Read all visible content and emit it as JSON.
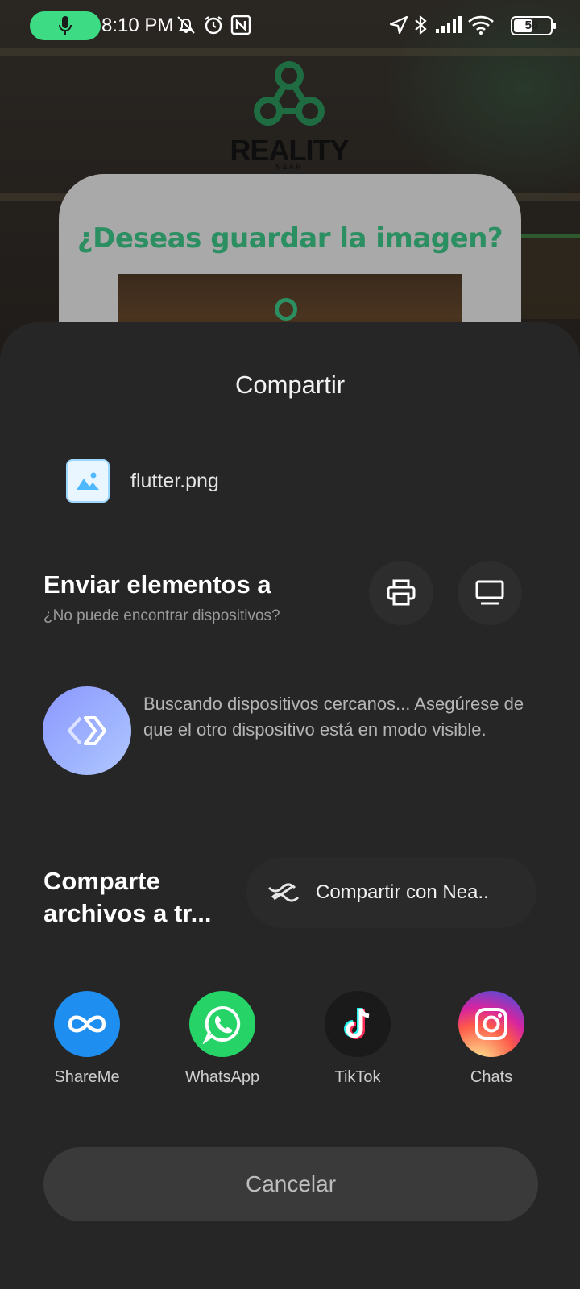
{
  "status_bar": {
    "time": "8:10 PM",
    "battery": "56",
    "battery_level": 0.56,
    "icons": [
      "mic-icon",
      "mute-bell-icon",
      "alarm-icon",
      "nfc-icon",
      "location-icon",
      "bluetooth-icon",
      "signal-icon",
      "wifi-icon",
      "battery-icon"
    ]
  },
  "background_app": {
    "logo_text": "REALITY",
    "logo_sub": "NEAR",
    "dialog_title": "¿Deseas guardar la imagen?",
    "accent": "#2b8f62"
  },
  "share_sheet": {
    "title": "Compartir",
    "file_name": "flutter.png",
    "send_title": "Enviar elementos a",
    "send_subtitle": "¿No puede encontrar dispositivos?",
    "nearby_text": "Buscando dispositivos cercanos... Asegúrese de que el otro dispositivo está en modo visible.",
    "share_via_title": "Comparte archivos a tr...",
    "nearby_share_label": "Compartir con Nea..",
    "apps": [
      {
        "label": "ShareMe",
        "icon": "shareme-icon",
        "color": "#1e8ff0"
      },
      {
        "label": "WhatsApp",
        "icon": "whatsapp-icon",
        "color": "#25d366"
      },
      {
        "label": "TikTok",
        "icon": "tiktok-icon",
        "color": "#1a1a1a"
      },
      {
        "label": "Chats",
        "icon": "instagram-icon",
        "color": "#e1306c"
      }
    ],
    "cancel_label": "Cancelar"
  }
}
